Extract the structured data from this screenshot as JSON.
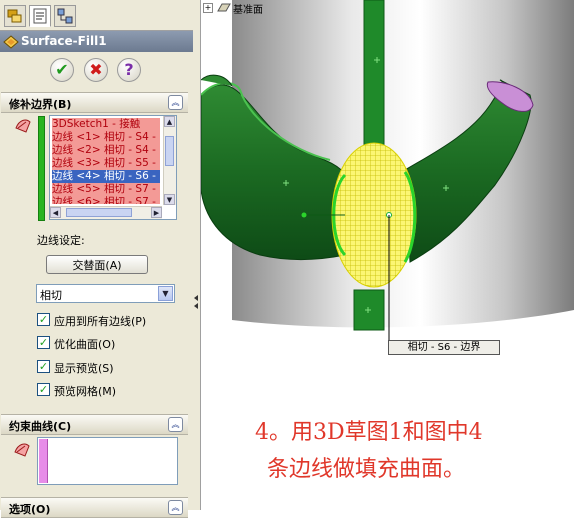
{
  "feature": {
    "title": "Surface-Fill1"
  },
  "actions": {
    "ok_icon": "check-icon",
    "cancel_icon": "x-icon",
    "help_icon": "help-icon",
    "ok_symbol": "✔",
    "cancel_symbol": "✖",
    "help_symbol": "?"
  },
  "patch_boundary": {
    "header": "修补边界(B)",
    "edges": [
      "3DSketch1 - 接触",
      "边线 <1> 相切 - S4 -",
      "边线 <2> 相切 - S4 -",
      "边线 <3> 相切 - S5 -",
      "边线 <4> 相切 - S6 -",
      "边线 <5> 相切 - S7 -",
      "边线 <6> 相切 - S7 -"
    ],
    "selected_index": 4,
    "edge_settings_label": "边线设定:",
    "alternate_face_button": "交替面(A)",
    "condition_value": "相切",
    "options": [
      {
        "label": "应用到所有边线(P)",
        "checked": true
      },
      {
        "label": "优化曲面(O)",
        "checked": true
      },
      {
        "label": "显示预览(S)",
        "checked": true
      },
      {
        "label": "预览网格(M)",
        "checked": true
      }
    ]
  },
  "constraint_curves": {
    "header": "约束曲线(C)"
  },
  "options_section": {
    "header": "选项(O)"
  },
  "viewport": {
    "tree_item": "基准面",
    "callout": "相切 - S6 - 边界",
    "caption_line1": "4。用3D草图1和图中4",
    "caption_line2": "条边线做填充曲面。"
  },
  "colors": {
    "accent_green": "#2e9a2a",
    "surface_green": "#1f6e25",
    "preview_yellow": "#f6f226",
    "caption_red": "#e0372a",
    "selection_blue": "#3a64c0",
    "edge_row_bg": "#f39a96"
  }
}
